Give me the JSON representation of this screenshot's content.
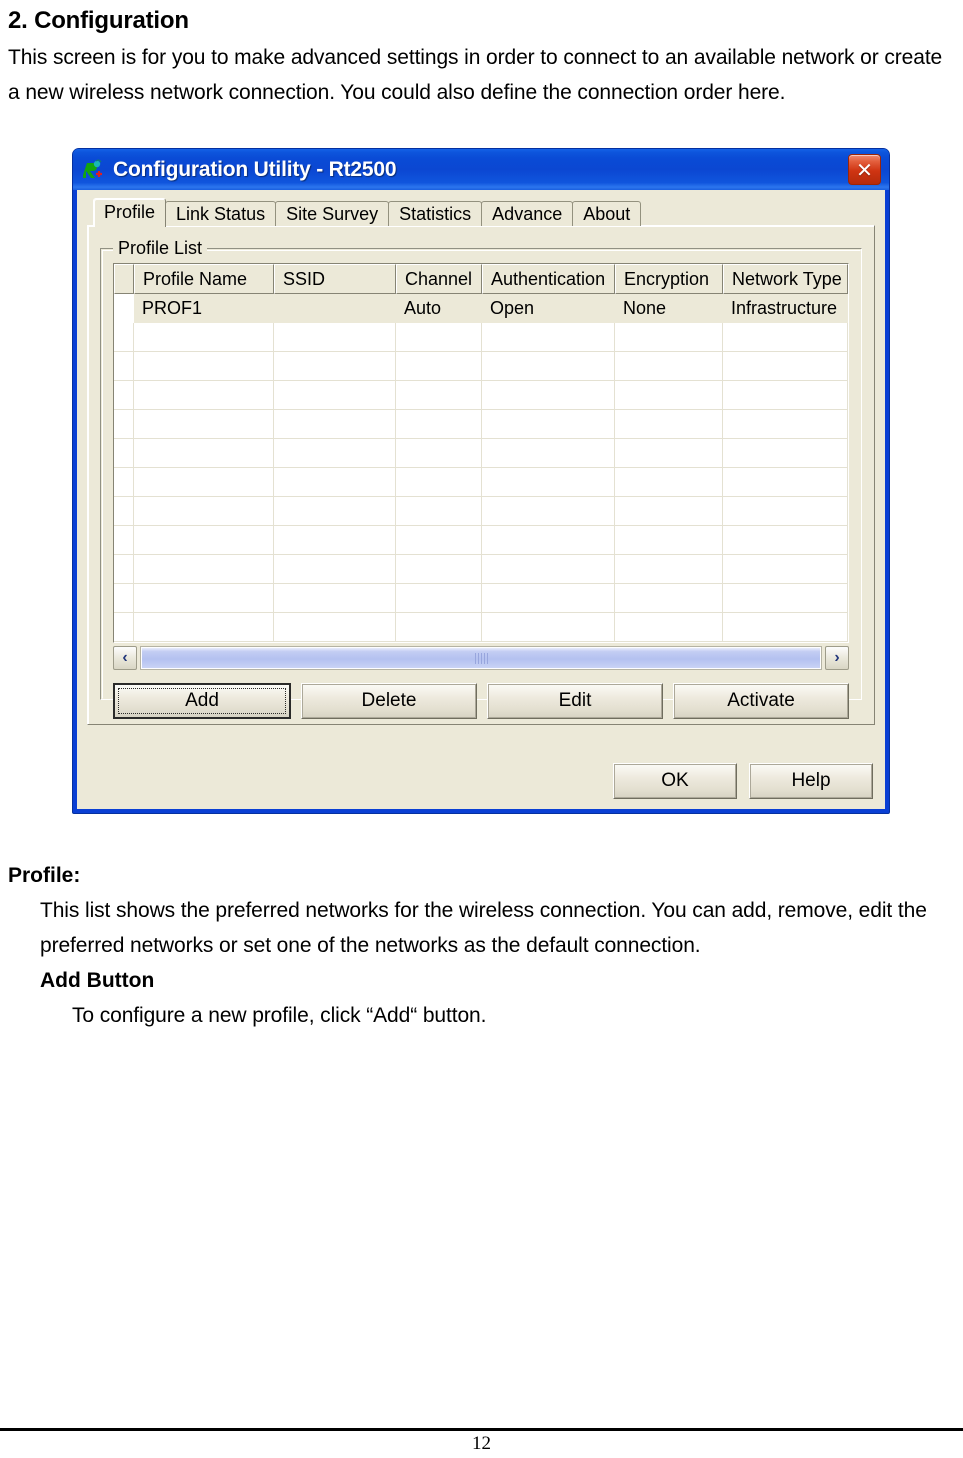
{
  "document": {
    "heading": "2. Configuration",
    "intro_paragraph": "This screen is for you to make advanced settings in order to connect to an available network or create a new wireless network connection. You could also define the connection order here.",
    "profile_label": "Profile:",
    "profile_description": "This list shows the preferred networks for the wireless connection. You can add, remove, edit the preferred networks or set one of the networks as the default connection.",
    "add_button_label": "Add Button",
    "add_button_description": "To configure a new profile, click “Add“ button.",
    "page_number": "12"
  },
  "window": {
    "title": "Configuration Utility - Rt2500",
    "icon": "ralink-r-icon",
    "close_label": "✕",
    "titlebar_color": "#0a4bd6",
    "face_color": "#ece9d8",
    "tabs": [
      {
        "label": "Profile",
        "active": true
      },
      {
        "label": "Link Status",
        "active": false
      },
      {
        "label": "Site Survey",
        "active": false
      },
      {
        "label": "Statistics",
        "active": false
      },
      {
        "label": "Advance",
        "active": false
      },
      {
        "label": "About",
        "active": false
      }
    ],
    "groupbox": {
      "title": "Profile List",
      "table": {
        "columns": [
          "Profile Name",
          "SSID",
          "Channel",
          "Authentication",
          "Encryption",
          "Network Type"
        ],
        "rows": [
          {
            "profile_name": "PROF1",
            "ssid": "",
            "channel": "Auto",
            "authentication": "Open",
            "encryption": "None",
            "network_type": "Infrastructure",
            "selected": true
          }
        ],
        "empty_row_count": 11
      },
      "scrollbar": {
        "left_arrow": "‹",
        "right_arrow": "›",
        "orientation": "horizontal",
        "thumb_full_width": true
      },
      "buttons": [
        {
          "label": "Add",
          "default": true
        },
        {
          "label": "Delete",
          "default": false
        },
        {
          "label": "Edit",
          "default": false
        },
        {
          "label": "Activate",
          "default": false
        }
      ]
    },
    "dialog_buttons": [
      {
        "label": "OK"
      },
      {
        "label": "Help"
      }
    ]
  }
}
